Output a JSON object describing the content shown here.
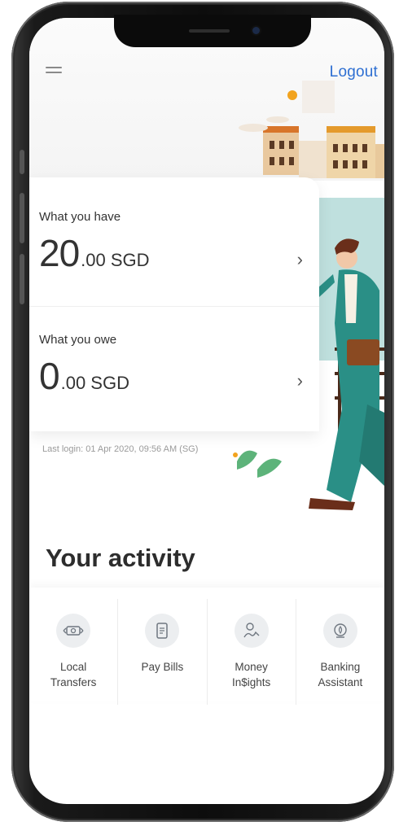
{
  "header": {
    "logout_label": "Logout"
  },
  "balances": {
    "have": {
      "label": "What you have",
      "amount_int": "20",
      "amount_dec": ".00 SGD"
    },
    "owe": {
      "label": "What you owe",
      "amount_int": "0",
      "amount_dec": ".00 SGD"
    }
  },
  "last_login": "Last login: 01 Apr 2020, 09:56 AM (SG)",
  "activity": {
    "title": "Your activity",
    "items": [
      {
        "label_line1": "Local",
        "label_line2": "Transfers",
        "icon": "transfer-icon"
      },
      {
        "label_line1": "Pay Bills",
        "label_line2": "",
        "icon": "bill-icon"
      },
      {
        "label_line1": "Money",
        "label_line2": "In$ights",
        "icon": "insights-icon"
      },
      {
        "label_line1": "Banking",
        "label_line2": "Assistant",
        "icon": "assistant-icon"
      }
    ]
  },
  "colors": {
    "accent": "#2e6fd2",
    "teal": "#2a8f86",
    "text": "#333333"
  }
}
